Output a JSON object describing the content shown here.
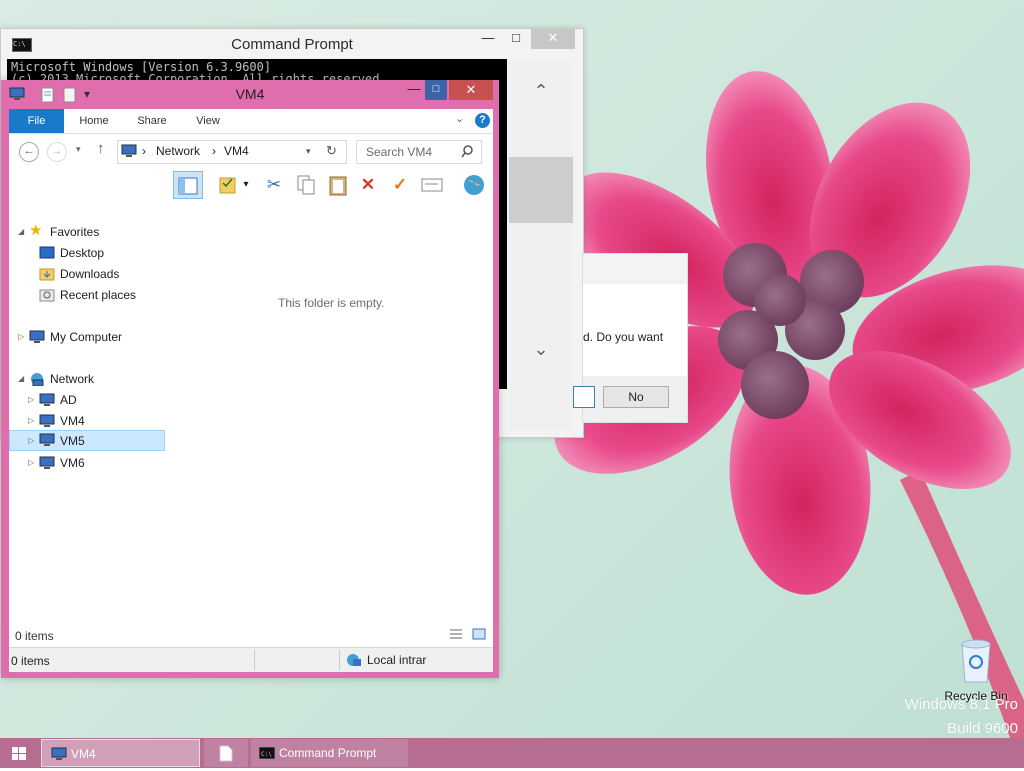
{
  "desktop": {
    "recycle_bin_label": "Recycle Bin",
    "watermark_line1": "Windows 8.1 Pro",
    "watermark_line2": "Build 9600"
  },
  "cmd": {
    "title": "Command Prompt",
    "minimize": "—",
    "maximize": "□",
    "close": "✕",
    "console_lines": [
      "Microsoft Windows [Version 6.3.9600]",
      "(c) 2013 Microsoft Corporation. All rights reserved."
    ],
    "scroll_up": "⌃",
    "scroll_down": "⌄"
  },
  "dialog": {
    "message": "d. Do you want",
    "no_button": "No"
  },
  "explorer": {
    "title": "VM4",
    "minimize": "—",
    "maximize": "□",
    "close": "✕",
    "ribbon": {
      "file": "File",
      "home": "Home",
      "share": "Share",
      "view": "View",
      "help": "?"
    },
    "address": {
      "segments": [
        "Network",
        "VM4"
      ],
      "separator": "›"
    },
    "search_placeholder": "Search VM4",
    "nav": {
      "favorites": "Favorites",
      "desktop": "Desktop",
      "downloads": "Downloads",
      "recent": "Recent places",
      "my_computer": "My Computer",
      "network": "Network",
      "ad": "AD",
      "vm4": "VM4",
      "vm5": "VM5",
      "vm6": "VM6"
    },
    "empty_message": "This folder is empty.",
    "status_items": "0 items",
    "statusbar_items": "0 items",
    "zone": "Local intrar"
  },
  "taskbar": {
    "items": [
      "VM4",
      "",
      "Command Prompt"
    ]
  },
  "colors": {
    "explorer_frame": "#e06eac",
    "taskbar": "#b56d92",
    "file_tab": "#1979ca",
    "selection": "#cce8ff"
  }
}
